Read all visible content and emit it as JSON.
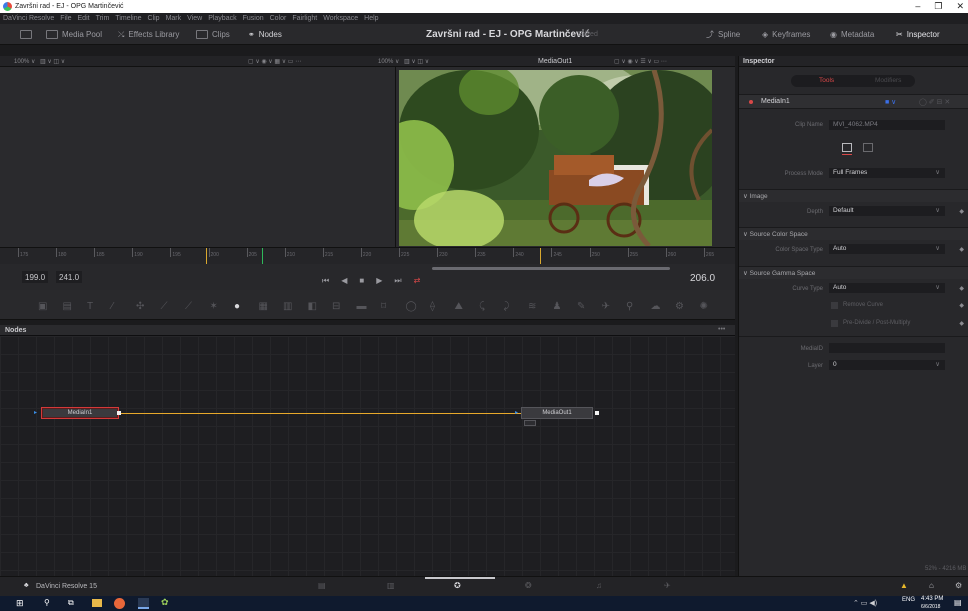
{
  "window": {
    "title": "Završni rad - EJ - OPG Martinčević",
    "controls": [
      "–",
      "❐",
      "✕"
    ]
  },
  "menu": [
    "DaVinci Resolve",
    "File",
    "Edit",
    "Trim",
    "Timeline",
    "Clip",
    "Mark",
    "View",
    "Playback",
    "Fusion",
    "Color",
    "Fairlight",
    "Workspace",
    "Help"
  ],
  "toolbar": {
    "media_pool": "Media Pool",
    "effects_library": "Effects Library",
    "clips": "Clips",
    "nodes": "Nodes",
    "project_title": "Završni rad - EJ - OPG Martinčević",
    "project_status": "Edited",
    "spline": "Spline",
    "keyframes": "Keyframes",
    "metadata": "Metadata",
    "inspector": "Inspector"
  },
  "viewer": {
    "left_zoom": "100% ∨",
    "right_zoom": "100% ∨",
    "right_name": "MediaOut1",
    "ruler_labels": [
      "175",
      "180",
      "185",
      "190",
      "195",
      "200",
      "205",
      "210",
      "215",
      "220",
      "225",
      "230",
      "235",
      "240",
      "245",
      "250",
      "255",
      "260",
      "265"
    ],
    "in_time": "199.0",
    "out_time": "241.0",
    "current_time": "206.0"
  },
  "nodes_panel": {
    "header": "Nodes",
    "more": "•••",
    "media_in": "MediaIn1",
    "media_out": "MediaOut1"
  },
  "inspector": {
    "header": "Inspector",
    "tab_tools": "Tools",
    "tab_modifiers": "Modifiers",
    "node_name": "MediaIn1",
    "clip_name_label": "Clip Name",
    "clip_name_value": "MVI_4062.MP4",
    "process_mode_label": "Process Mode",
    "process_mode_value": "Full Frames",
    "section_image": "Image",
    "depth_label": "Depth",
    "depth_value": "Default",
    "section_color_space": "Source Color Space",
    "color_space_type_label": "Color Space Type",
    "color_space_type_value": "Auto",
    "section_gamma": "Source Gamma Space",
    "curve_type_label": "Curve Type",
    "curve_type_value": "Auto",
    "remove_curve": "Remove Curve",
    "pre_divide": "Pre-Divide / Post-Multiply",
    "media_id_label": "MediaID",
    "layer_label": "Layer",
    "layer_value": "0",
    "footer_stats": "52% - 4216 MB"
  },
  "pagebar": {
    "app_name": "DaVinci Resolve 15"
  },
  "taskbar": {
    "lang": "ENG",
    "time": "4:43 PM",
    "date": "6/6/2018"
  }
}
